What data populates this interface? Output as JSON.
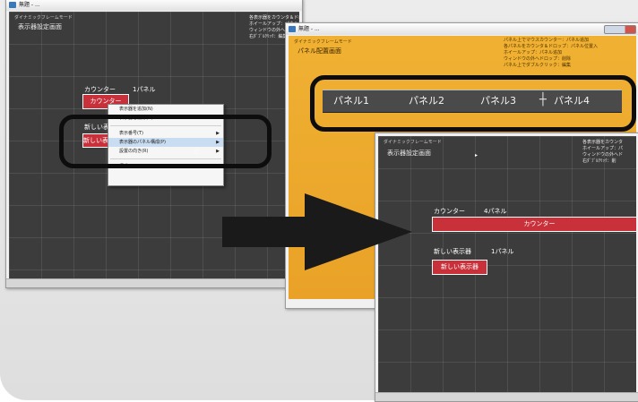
{
  "window_title": "無題 - ...",
  "mode_label": "ダイナミックフレームモード",
  "screen_title": "表示器設定画面",
  "panel_screen_title": "パネル配置画面",
  "help_text": "各表示器をカウンタ＆ドロップ：表示器位置移動\nホイールアップ：パネル追加\nウィンドウの外へドロップ：削除\n右ﾀﾞﾌﾞﾙｸﾘｯｸ：編集",
  "help_text_panel": "パネル上でマウスカウンター：パネル追加\n各パネルをカウンタ＆ドロップ：パネル位置入\nホイールアップ：パネル追加\nウィンドウの外へドロップ：削除\nパネル上でダブルクリック：編集",
  "help_text_short": "各表示器をカウンタ\nホイールアップ：パ\nウィンドウの外へド\n右ﾀﾞﾌﾞﾙｸﾘｯｸ：削",
  "counter_label": "カウンター",
  "panel1_label": "1パネル",
  "panel4_label": "4パネル",
  "counter_button": "カウンター",
  "new_display_label": "新しい表示器",
  "new_display_panel": "1パネル",
  "new_display_button": "新しい表示器",
  "context_menu": {
    "items": [
      {
        "label": "表示器を追加(N)",
        "arrow": ""
      },
      {
        "label": "表示器を削除(D)",
        "arrow": ""
      },
      {
        "label": "表示番号(T)",
        "arrow": "▶"
      },
      {
        "label": "表示器のパネル構成(P)",
        "arrow": "▶"
      },
      {
        "label": "設置の向き(R)",
        "arrow": "▶"
      },
      {
        "label": "構成(S)",
        "arrow": "▶"
      }
    ]
  },
  "panels": [
    "パネル1",
    "パネル2",
    "パネル3",
    "パネル4"
  ],
  "colors": {
    "dark_client": "#3c3c3c",
    "orange_client": "#eda42a",
    "red_display": "#c8303a",
    "ring": "#0d0d0d"
  }
}
